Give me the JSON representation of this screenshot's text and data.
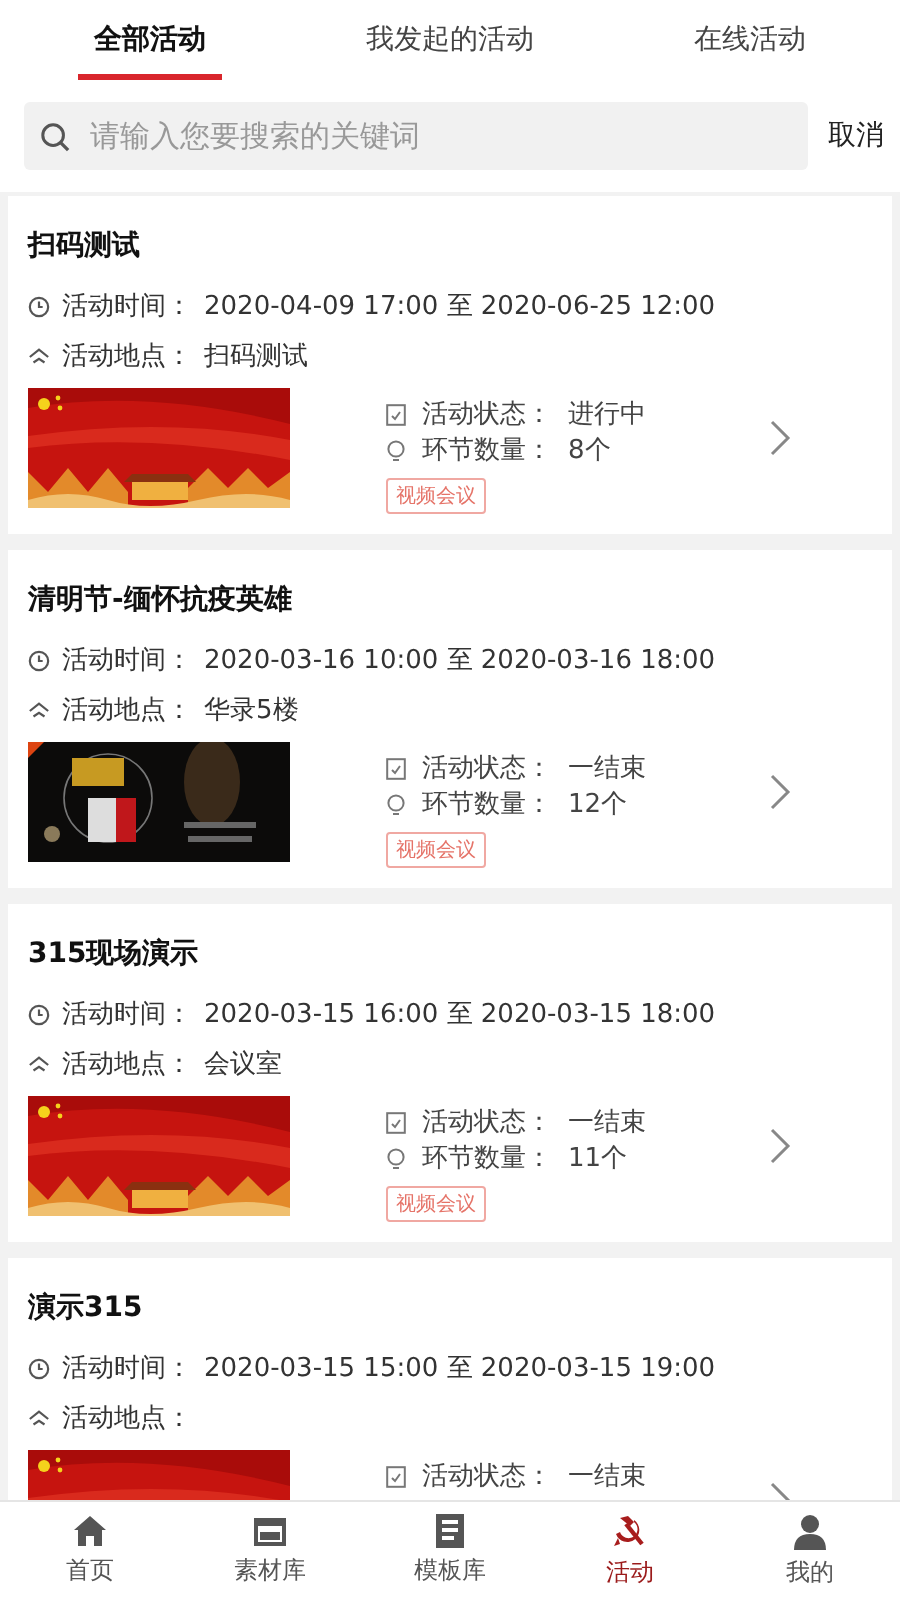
{
  "tabs": [
    {
      "label": "全部活动",
      "selected": true
    },
    {
      "label": "我发起的活动",
      "selected": false
    },
    {
      "label": "在线活动",
      "selected": false
    }
  ],
  "search": {
    "placeholder": "请输入您要搜索的关键词",
    "cancel": "取消"
  },
  "activities": [
    {
      "title": "扫码测试",
      "time_label": "活动时间：",
      "time": "2020-04-09 17:00 至 2020-06-25 12:00",
      "place_label": "活动地点：",
      "place": "扫码测试",
      "status_label": "活动状态：",
      "status": "进行中",
      "count_label": "环节数量：",
      "count": "8个",
      "tag": "视频会议"
    },
    {
      "title": "清明节-缅怀抗疫英雄",
      "time_label": "活动时间：",
      "time": "2020-03-16 10:00 至 2020-03-16 18:00",
      "place_label": "活动地点：",
      "place": "华录5楼",
      "status_label": "活动状态：",
      "status": "一结束",
      "count_label": "环节数量：",
      "count": "12个",
      "tag": "视频会议"
    },
    {
      "title": "315现场演示",
      "time_label": "活动时间：",
      "time": "2020-03-15 16:00 至 2020-03-15 18:00",
      "place_label": "活动地点：",
      "place": "会议室",
      "status_label": "活动状态：",
      "status": "一结束",
      "count_label": "环节数量：",
      "count": "11个",
      "tag": "视频会议"
    },
    {
      "title": "演示315",
      "time_label": "活动时间：",
      "time": "2020-03-15 15:00 至 2020-03-15 19:00",
      "place_label": "活动地点：",
      "status_label": "活动状态：",
      "status": "一结束"
    }
  ],
  "nav": [
    {
      "label": "首页",
      "selected": false
    },
    {
      "label": "素材库",
      "selected": false
    },
    {
      "label": "模板库",
      "selected": false
    },
    {
      "label": "活动",
      "selected": true
    },
    {
      "label": "我的",
      "selected": false
    }
  ]
}
